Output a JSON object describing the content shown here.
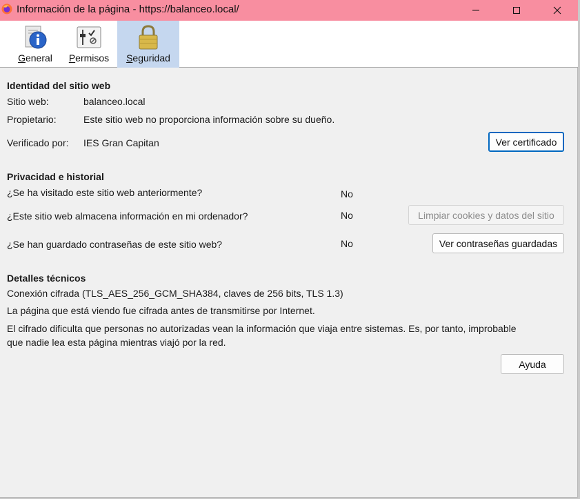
{
  "window": {
    "title": "Información de la página - https://balanceo.local/"
  },
  "tabs": [
    {
      "label": "General",
      "icon": "info-icon",
      "selected": false
    },
    {
      "label": "Permisos",
      "icon": "permissions-icon",
      "selected": false
    },
    {
      "label": "Seguridad",
      "icon": "padlock-icon",
      "selected": true
    }
  ],
  "identity": {
    "heading": "Identidad del sitio web",
    "site_label": "Sitio web:",
    "site_value": "balanceo.local",
    "owner_label": "Propietario:",
    "owner_value": "Este sitio web no proporciona información sobre su dueño.",
    "verified_label": "Verificado por:",
    "verified_value": "IES Gran Capitan",
    "view_cert_button": "Ver certificado"
  },
  "privacy": {
    "heading": "Privacidad e historial",
    "q1": "¿Se ha visitado este sitio web anteriormente?",
    "a1": "No",
    "q2": "¿Este sitio web almacena información en mi ordenador?",
    "a2": "No",
    "clear_button": "Limpiar cookies y datos del sitio",
    "q3": "¿Se han guardado contraseñas de este sitio web?",
    "a3": "No",
    "passwords_button": "Ver contraseñas guardadas"
  },
  "technical": {
    "heading": "Detalles técnicos",
    "line1": "Conexión cifrada (TLS_AES_256_GCM_SHA384, claves de 256 bits, TLS 1.3)",
    "line2": "La página que está viendo fue cifrada antes de transmitirse por Internet.",
    "line3": "El cifrado dificulta que personas no autorizadas vean la información que viaja entre sistemas. Es, por tanto, improbable",
    "line4": "que nadie lea esta página mientras viajó por la red."
  },
  "help_button": "Ayuda",
  "colors": {
    "titlebar": "#f88ea0",
    "selected_tab": "#c5d7ef",
    "focus_border": "#0067c0"
  }
}
